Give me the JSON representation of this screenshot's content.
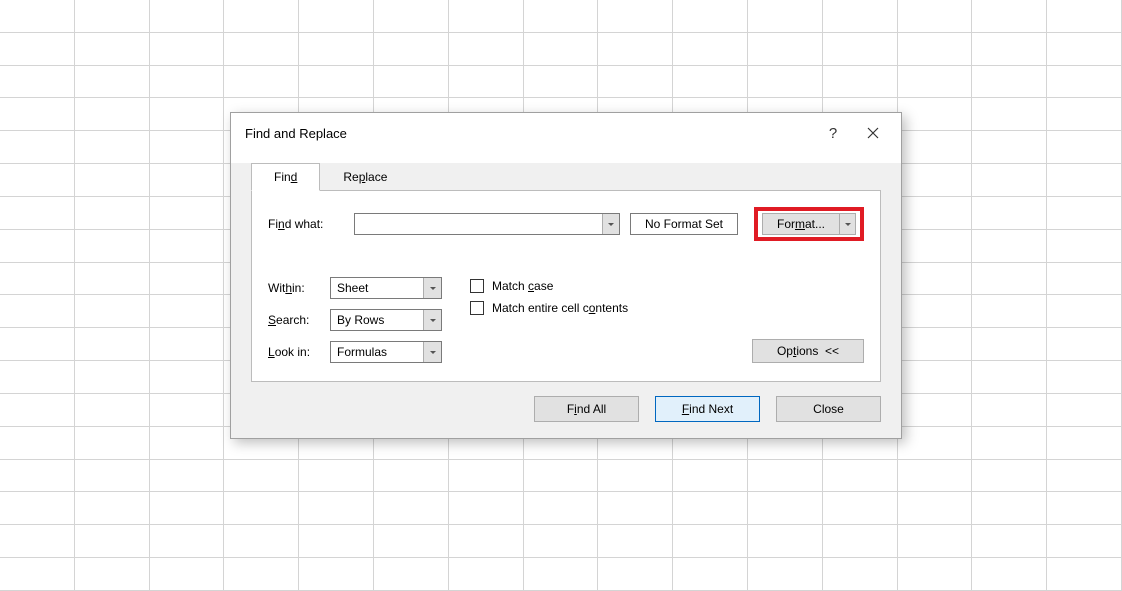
{
  "dialog": {
    "title": "Find and Replace",
    "tabs": {
      "find": "Find",
      "replace": "Replace"
    },
    "find_what_label": "Find what:",
    "find_what_value": "",
    "no_format_set": "No Format Set",
    "format_button": "Format...",
    "within_label": "Within:",
    "within_value": "Sheet",
    "search_label": "Search:",
    "search_value": "By Rows",
    "lookin_label": "Look in:",
    "lookin_value": "Formulas",
    "match_case": "Match case",
    "match_entire": "Match entire cell contents",
    "options_button": "Options <<",
    "find_all": "Find All",
    "find_next": "Find Next",
    "close": "Close"
  }
}
